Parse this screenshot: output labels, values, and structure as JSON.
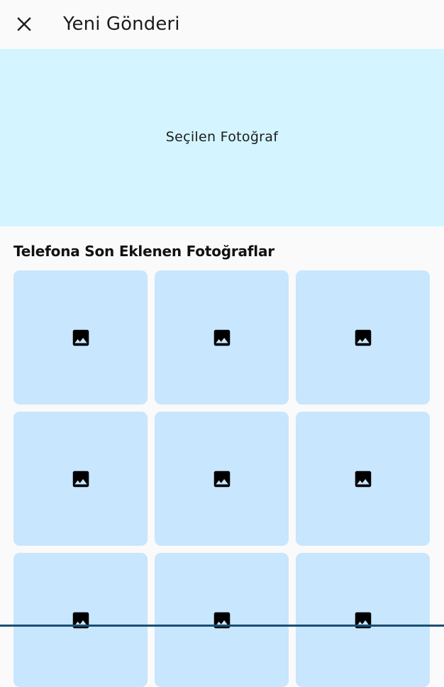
{
  "appbar": {
    "title": "Yeni Gönderi",
    "close_icon": "close-icon"
  },
  "selected_photo": {
    "label": "Seçilen Fotoğraf"
  },
  "recent_photos": {
    "heading": "Telefona Son Eklenen Fotoğraflar",
    "items": [
      {
        "icon": "image-icon"
      },
      {
        "icon": "image-icon"
      },
      {
        "icon": "image-icon"
      },
      {
        "icon": "image-icon"
      },
      {
        "icon": "image-icon"
      },
      {
        "icon": "image-icon"
      },
      {
        "icon": "image-icon"
      },
      {
        "icon": "image-icon"
      },
      {
        "icon": "image-icon"
      }
    ]
  },
  "colors": {
    "selected_photo_bg": "#d4f4ff",
    "tile_bg": "#c8e6fd",
    "page_bg": "#fafafa"
  }
}
